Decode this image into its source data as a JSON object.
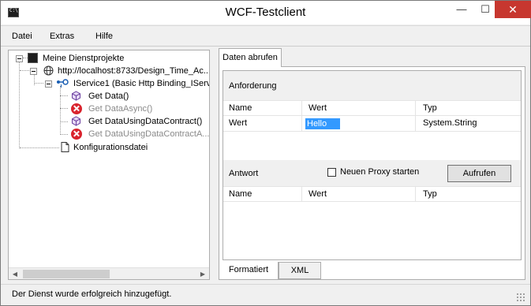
{
  "window": {
    "title": "WCF-Testclient",
    "icon": "console-icon",
    "controls": {
      "minimize": "—",
      "maximize": "☐",
      "close": "✕"
    }
  },
  "menu": [
    "Datei",
    "Extras",
    "Hilfe"
  ],
  "tree": {
    "root": "Meine Dienstprojekte",
    "endpoint": "http://localhost:8733/Design_Time_Ac...",
    "service": "IService1 (Basic Http Binding_IServ...",
    "operations": [
      {
        "label": "Get Data()",
        "icon": "operation-icon",
        "disabled": false
      },
      {
        "label": "Get DataAsync()",
        "icon": "error-icon",
        "disabled": true
      },
      {
        "label": "Get DataUsingDataContract()",
        "icon": "operation-icon",
        "disabled": false
      },
      {
        "label": "Get DataUsingDataContractA...",
        "icon": "error-icon",
        "disabled": true
      }
    ],
    "config_file": "Konfigurationsdatei"
  },
  "tab": {
    "label": "Daten abrufen"
  },
  "request": {
    "header": "Anforderung",
    "columns": [
      "Name",
      "Wert",
      "Typ"
    ],
    "rows": [
      {
        "name": "Wert",
        "value": "Hello",
        "type": "System.String"
      }
    ]
  },
  "response": {
    "header": "Antwort",
    "checkbox_label": "Neuen Proxy starten",
    "checkbox_checked": false,
    "invoke_button": "Aufrufen",
    "columns": [
      "Name",
      "Wert",
      "Typ"
    ]
  },
  "bottom_tabs": [
    {
      "label": "Formatiert",
      "active": true
    },
    {
      "label": "XML",
      "active": false
    }
  ],
  "status": "Der Dienst wurde erfolgreich hinzugefügt.",
  "colors": {
    "accent": "#3399ff",
    "close_button": "#c7372f",
    "error": "#d9232d"
  }
}
